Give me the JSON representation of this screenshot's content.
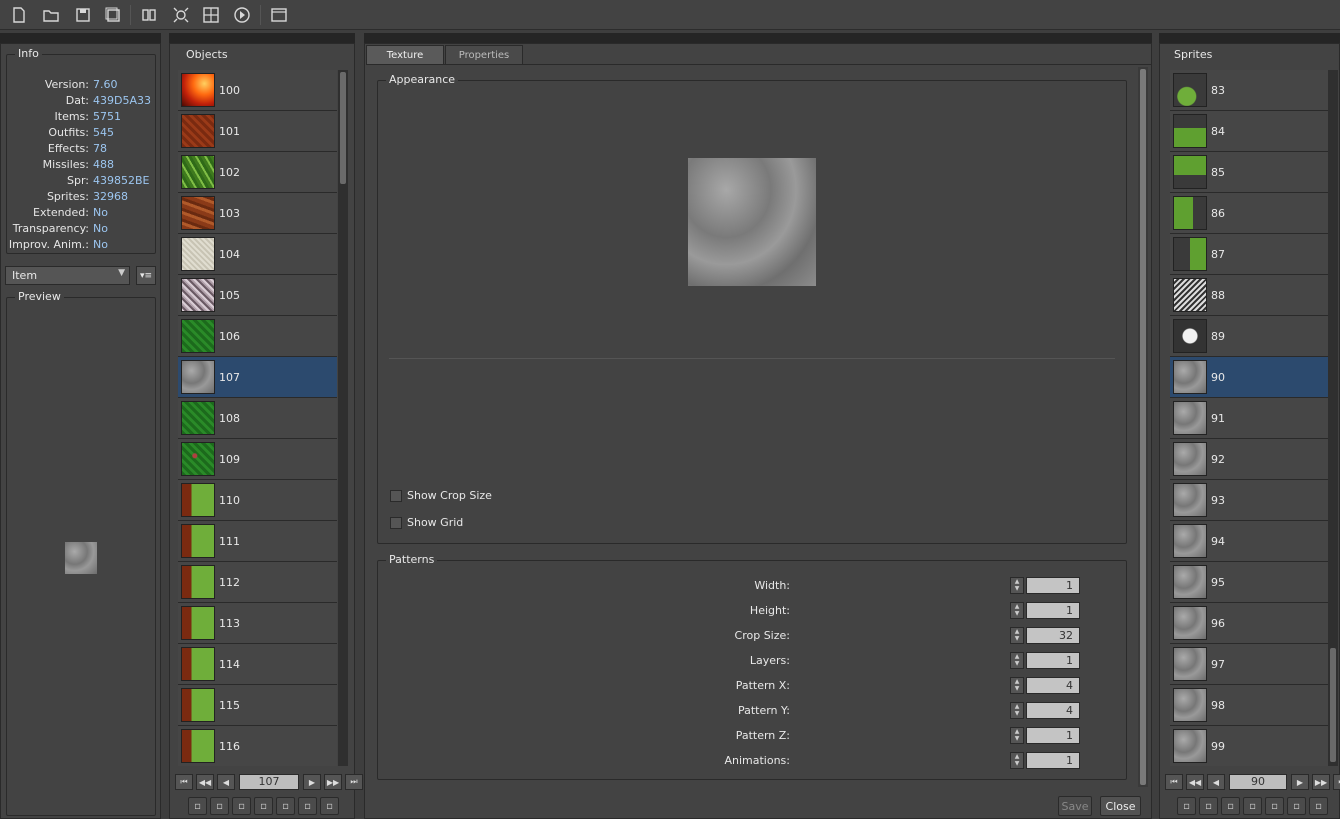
{
  "toolbar": {
    "icons": [
      "new-file-icon",
      "open-folder-icon",
      "save-icon",
      "save-as-icon",
      "find-icon",
      "zoom-fit-icon",
      "sprite-grid-icon",
      "play-icon",
      "console-icon"
    ]
  },
  "info": {
    "title": "Info",
    "rows": [
      {
        "key": "Version:",
        "value": "7.60"
      },
      {
        "key": "Dat:",
        "value": "439D5A33"
      },
      {
        "key": "Items:",
        "value": "5751"
      },
      {
        "key": "Outfits:",
        "value": "545"
      },
      {
        "key": "Effects:",
        "value": "78"
      },
      {
        "key": "Missiles:",
        "value": "488"
      },
      {
        "key": "Spr:",
        "value": "439852BE"
      },
      {
        "key": "Sprites:",
        "value": "32968"
      },
      {
        "key": "Extended:",
        "value": "No"
      },
      {
        "key": "Transparency:",
        "value": "No"
      },
      {
        "key": "Improv. Anim.:",
        "value": "No"
      }
    ]
  },
  "category_select": {
    "value": "Item"
  },
  "preview": {
    "title": "Preview"
  },
  "objects": {
    "title": "Objects",
    "items": [
      {
        "label": "100",
        "tex": "fire"
      },
      {
        "label": "101",
        "tex": "dirt"
      },
      {
        "label": "102",
        "tex": "grass"
      },
      {
        "label": "103",
        "tex": "rock"
      },
      {
        "label": "104",
        "tex": "sand"
      },
      {
        "label": "105",
        "tex": "gravel"
      },
      {
        "label": "106",
        "tex": "darkgrass"
      },
      {
        "label": "107",
        "tex": "stone"
      },
      {
        "label": "108",
        "tex": "darkgrass"
      },
      {
        "label": "109",
        "tex": "flowers"
      },
      {
        "label": "110",
        "tex": "grassedge"
      },
      {
        "label": "111",
        "tex": "grassedge"
      },
      {
        "label": "112",
        "tex": "grassedge"
      },
      {
        "label": "113",
        "tex": "grassedge"
      },
      {
        "label": "114",
        "tex": "grassedge"
      },
      {
        "label": "115",
        "tex": "grassedge"
      },
      {
        "label": "116",
        "tex": "grassedge"
      }
    ],
    "selected_index": 7,
    "page_value": "107"
  },
  "editor": {
    "tabs": [
      {
        "label": "Texture"
      },
      {
        "label": "Properties"
      }
    ],
    "appearance_title": "Appearance",
    "show_crop_size": "Show Crop Size",
    "show_grid": "Show Grid",
    "patterns_title": "Patterns",
    "patterns": [
      {
        "label": "Width:",
        "value": "1"
      },
      {
        "label": "Height:",
        "value": "1"
      },
      {
        "label": "Crop Size:",
        "value": "32"
      },
      {
        "label": "Layers:",
        "value": "1"
      },
      {
        "label": "Pattern X:",
        "value": "4"
      },
      {
        "label": "Pattern Y:",
        "value": "4"
      },
      {
        "label": "Pattern Z:",
        "value": "1"
      },
      {
        "label": "Animations:",
        "value": "1"
      }
    ],
    "save_label": "Save",
    "close_label": "Close"
  },
  "sprites": {
    "title": "Sprites",
    "items": [
      {
        "label": "83",
        "tex": "grasssmall"
      },
      {
        "label": "84",
        "tex": "grassbottom"
      },
      {
        "label": "85",
        "tex": "grasstop"
      },
      {
        "label": "86",
        "tex": "grassleft"
      },
      {
        "label": "87",
        "tex": "grassright"
      },
      {
        "label": "88",
        "tex": "skeleton"
      },
      {
        "label": "89",
        "tex": "fishbone"
      },
      {
        "label": "90",
        "tex": "stone"
      },
      {
        "label": "91",
        "tex": "stone"
      },
      {
        "label": "92",
        "tex": "stone"
      },
      {
        "label": "93",
        "tex": "stone"
      },
      {
        "label": "94",
        "tex": "stone"
      },
      {
        "label": "95",
        "tex": "stone"
      },
      {
        "label": "96",
        "tex": "stone"
      },
      {
        "label": "97",
        "tex": "stone"
      },
      {
        "label": "98",
        "tex": "stone"
      },
      {
        "label": "99",
        "tex": "stone"
      }
    ],
    "selected_index": 7,
    "page_value": "90"
  }
}
